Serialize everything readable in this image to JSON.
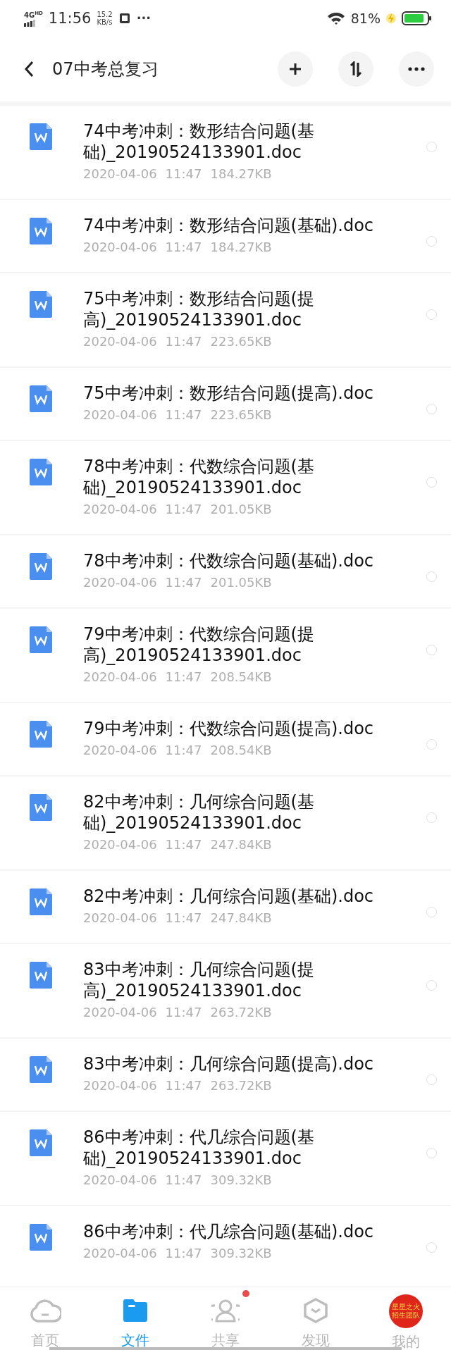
{
  "status_bar": {
    "network": "4G",
    "network_suffix": "HD",
    "time": "11:56",
    "speed_value": "15.2",
    "speed_unit": "KB/s",
    "more": "···",
    "battery": "81%"
  },
  "header": {
    "title": "07中考总复习"
  },
  "files": [
    {
      "name": "74中考冲刺：数形结合问题(基础)_20190524133901.doc",
      "date": "2020-04-06",
      "time": "11:47",
      "size": "184.27KB",
      "selected": false
    },
    {
      "name": "74中考冲刺：数形结合问题(基础).doc",
      "date": "2020-04-06",
      "time": "11:47",
      "size": "184.27KB",
      "selected": false
    },
    {
      "name": "75中考冲刺：数形结合问题(提高)_20190524133901.doc",
      "date": "2020-04-06",
      "time": "11:47",
      "size": "223.65KB",
      "selected": false
    },
    {
      "name": "75中考冲刺：数形结合问题(提高).doc",
      "date": "2020-04-06",
      "time": "11:47",
      "size": "223.65KB",
      "selected": false
    },
    {
      "name": "78中考冲刺：代数综合问题(基础)_20190524133901.doc",
      "date": "2020-04-06",
      "time": "11:47",
      "size": "201.05KB",
      "selected": false
    },
    {
      "name": "78中考冲刺：代数综合问题(基础).doc",
      "date": "2020-04-06",
      "time": "11:47",
      "size": "201.05KB",
      "selected": false
    },
    {
      "name": "79中考冲刺：代数综合问题(提高)_20190524133901.doc",
      "date": "2020-04-06",
      "time": "11:47",
      "size": "208.54KB",
      "selected": false
    },
    {
      "name": "79中考冲刺：代数综合问题(提高).doc",
      "date": "2020-04-06",
      "time": "11:47",
      "size": "208.54KB",
      "selected": false
    },
    {
      "name": "82中考冲刺：几何综合问题(基础)_20190524133901.doc",
      "date": "2020-04-06",
      "time": "11:47",
      "size": "247.84KB",
      "selected": false
    },
    {
      "name": "82中考冲刺：几何综合问题(基础).doc",
      "date": "2020-04-06",
      "time": "11:47",
      "size": "247.84KB",
      "selected": false
    },
    {
      "name": "83中考冲刺：几何综合问题(提高)_20190524133901.doc",
      "date": "2020-04-06",
      "time": "11:47",
      "size": "263.72KB",
      "selected": false
    },
    {
      "name": "83中考冲刺：几何综合问题(提高).doc",
      "date": "2020-04-06",
      "time": "11:47",
      "size": "263.72KB",
      "selected": false
    },
    {
      "name": "86中考冲刺：代几综合问题(基础)_20190524133901.doc",
      "date": "2020-04-06",
      "time": "11:47",
      "size": "309.32KB",
      "selected": false
    },
    {
      "name": "86中考冲刺：代几综合问题(基础).doc",
      "date": "2020-04-06",
      "time": "11:47",
      "size": "309.32KB",
      "selected": false
    }
  ],
  "tabs": [
    {
      "kind": "home",
      "label": "首页",
      "selected": false,
      "badge": false
    },
    {
      "kind": "files",
      "label": "文件",
      "selected": true,
      "badge": false
    },
    {
      "kind": "share",
      "label": "共享",
      "selected": false,
      "badge": true
    },
    {
      "kind": "discover",
      "label": "发现",
      "selected": false,
      "badge": false
    },
    {
      "kind": "me",
      "label": "我的",
      "selected": false,
      "badge": false,
      "avatar_lines": [
        "星星之火",
        "招生团队"
      ]
    }
  ]
}
